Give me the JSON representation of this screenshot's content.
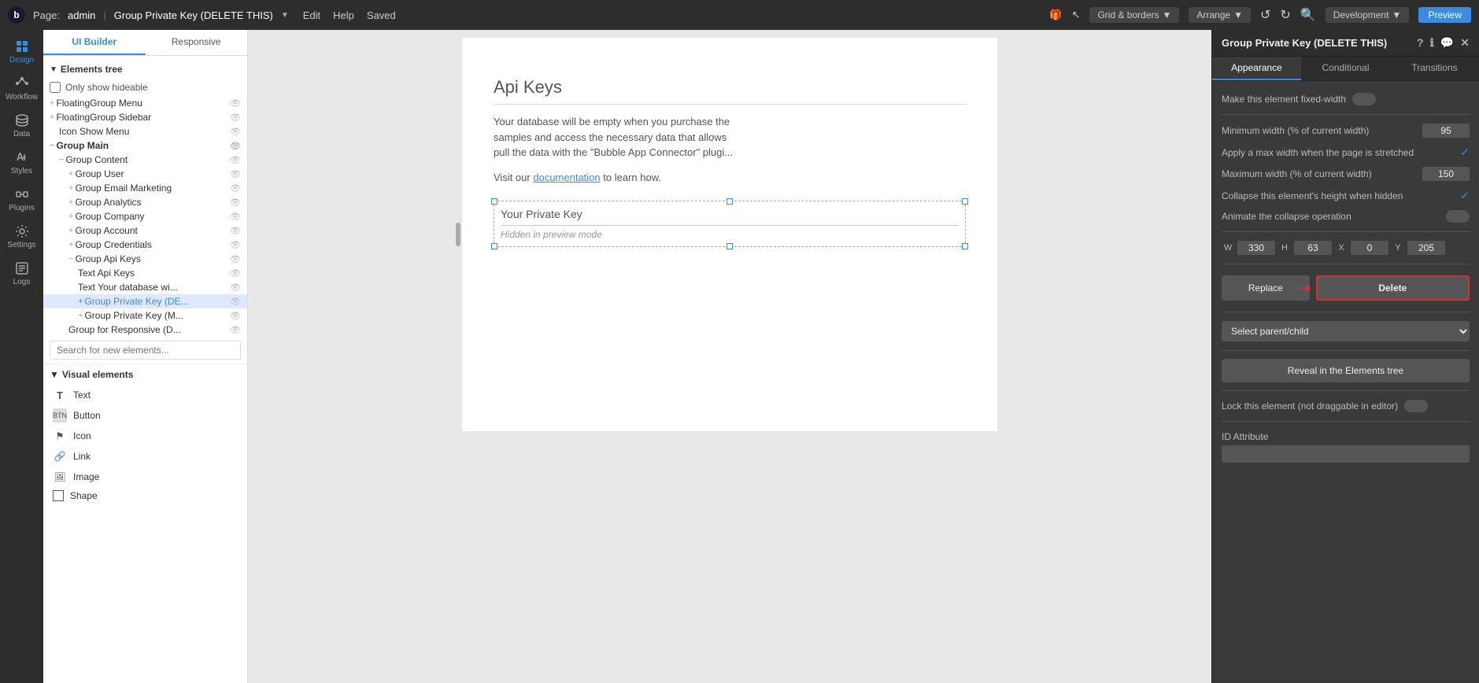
{
  "topbar": {
    "logo": "b",
    "page_label": "Page:",
    "page_name": "admin",
    "document_name": "Group Private Key (DELETE THIS)",
    "actions": [
      "Edit",
      "Help"
    ],
    "saved_label": "Saved",
    "grid_borders": "Grid & borders",
    "arrange": "Arrange",
    "mode_label": "Development",
    "preview_label": "Preview"
  },
  "left_panel": {
    "tabs": [
      "UI Builder",
      "Responsive"
    ],
    "elements_tree_label": "Elements tree",
    "only_show_hideable": "Only show hideable",
    "tree_items": [
      {
        "label": "FloatingGroup Menu",
        "indent": 0,
        "prefix": "+",
        "eye": true
      },
      {
        "label": "FloatingGroup Sidebar",
        "indent": 0,
        "prefix": "+",
        "eye": true
      },
      {
        "label": "Icon Show Menu",
        "indent": 1,
        "prefix": "",
        "eye": true
      },
      {
        "label": "Group Main",
        "indent": 0,
        "prefix": "-",
        "eye": false
      },
      {
        "label": "Group Content",
        "indent": 1,
        "prefix": "-",
        "eye": false
      },
      {
        "label": "Group User",
        "indent": 2,
        "prefix": "+",
        "eye": true
      },
      {
        "label": "Group Email Marketing",
        "indent": 2,
        "prefix": "+",
        "eye": true
      },
      {
        "label": "Group Analytics",
        "indent": 2,
        "prefix": "+",
        "eye": true
      },
      {
        "label": "Group Company",
        "indent": 2,
        "prefix": "+",
        "eye": true
      },
      {
        "label": "Group Account",
        "indent": 2,
        "prefix": "+",
        "eye": true
      },
      {
        "label": "Group Credentials",
        "indent": 2,
        "prefix": "+",
        "eye": true
      },
      {
        "label": "Group Api Keys",
        "indent": 2,
        "prefix": "-",
        "eye": true,
        "selected": false
      },
      {
        "label": "Text Api Keys",
        "indent": 3,
        "prefix": "",
        "eye": false
      },
      {
        "label": "Text Your database wi...",
        "indent": 3,
        "prefix": "",
        "eye": false
      },
      {
        "label": "Group Private Key (DE...",
        "indent": 3,
        "prefix": "+",
        "eye": false,
        "selected": true,
        "highlighted": true
      },
      {
        "label": "Group Private Key (M...",
        "indent": 3,
        "prefix": "+",
        "eye": false
      },
      {
        "label": "Group for Responsive (D...",
        "indent": 2,
        "prefix": "",
        "eye": true
      }
    ],
    "search_placeholder": "Search for new elements...",
    "visual_elements_label": "Visual elements",
    "visual_elements": [
      {
        "label": "Text",
        "icon": "T"
      },
      {
        "label": "Button",
        "icon": "BTN"
      },
      {
        "label": "Icon",
        "icon": "⚑"
      },
      {
        "label": "Link",
        "icon": "🔗"
      },
      {
        "label": "Image",
        "icon": "🖼"
      },
      {
        "label": "Shape",
        "icon": "□"
      }
    ]
  },
  "canvas": {
    "api_keys_title": "Api Keys",
    "api_keys_desc1": "Your database will be empty when you purchase the",
    "api_keys_desc2": "samples and access the necessary data that allows",
    "api_keys_desc3": "pull the data with the \"Bubble App Connector\" plugi...",
    "visit_text": "Visit our",
    "documentation_link": "documentation",
    "visit_suffix": "to learn how.",
    "private_key_label": "Your Private Key",
    "hidden_preview": "Hidden in preview mode"
  },
  "right_panel": {
    "title": "Group Private Key (DELETE THIS)",
    "tabs": [
      "Appearance",
      "Conditional",
      "Transitions"
    ],
    "active_tab": "Appearance",
    "fixed_width_label": "Make this element fixed-width",
    "min_width_label": "Minimum width (% of current width)",
    "min_width_value": "95",
    "max_width_label": "Apply a max width when the page is stretched",
    "max_width_value_label": "Maximum width (% of current width)",
    "max_width_value": "150",
    "collapse_label": "Collapse this element's height when hidden",
    "animate_label": "Animate the collapse operation",
    "w_label": "W",
    "h_label": "H",
    "x_label": "X",
    "y_label": "Y",
    "w_value": "330",
    "h_value": "63",
    "x_value": "0",
    "y_value": "205",
    "replace_label": "Replace",
    "delete_label": "Delete",
    "select_parent_label": "Select parent/child",
    "reveal_label": "Reveal in the Elements tree",
    "lock_label": "Lock this element (not draggable in editor)",
    "id_attribute_label": "ID Attribute"
  }
}
